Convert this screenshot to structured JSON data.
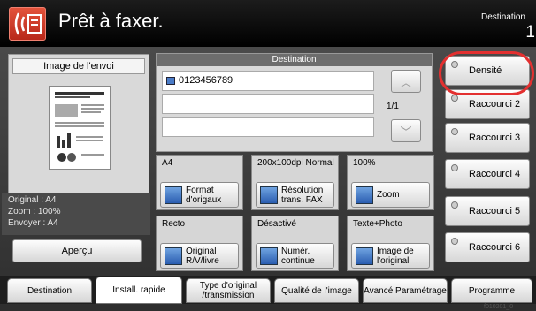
{
  "header": {
    "title": "Prêt à faxer.",
    "destination_label": "Destination",
    "destination_count": "1"
  },
  "preview": {
    "title": "Image de l'envoi",
    "info": [
      "Original   : A4",
      "Zoom      : 100%",
      "Envoyer   : A4"
    ],
    "button": "Aperçu"
  },
  "destination": {
    "header": "Destination",
    "rows": [
      "0123456789",
      "",
      ""
    ],
    "page_indicator": "1/1"
  },
  "functions": [
    {
      "top": "A4",
      "button": "Format d'origaux"
    },
    {
      "top": "200x100dpi Normal",
      "button": "Résolution trans. FAX"
    },
    {
      "top": "100%",
      "button": "Zoom"
    },
    {
      "top": "Recto",
      "button": "Original R/V/livre"
    },
    {
      "top": "Désactivé",
      "button": "Numér. continue"
    },
    {
      "top": "Texte+Photo",
      "button": "Image de l'original"
    }
  ],
  "shortcuts": [
    "Densité",
    "Raccourci 2",
    "Raccourci 3",
    "Raccourci 4",
    "Raccourci 5",
    "Raccourci 6"
  ],
  "tabs": [
    "Destination",
    "Install. rapide",
    "Type d'original /transmission",
    "Qualité de l'image",
    "Avancé Paramétrage",
    "Programme"
  ],
  "image_id": "f010201_0"
}
